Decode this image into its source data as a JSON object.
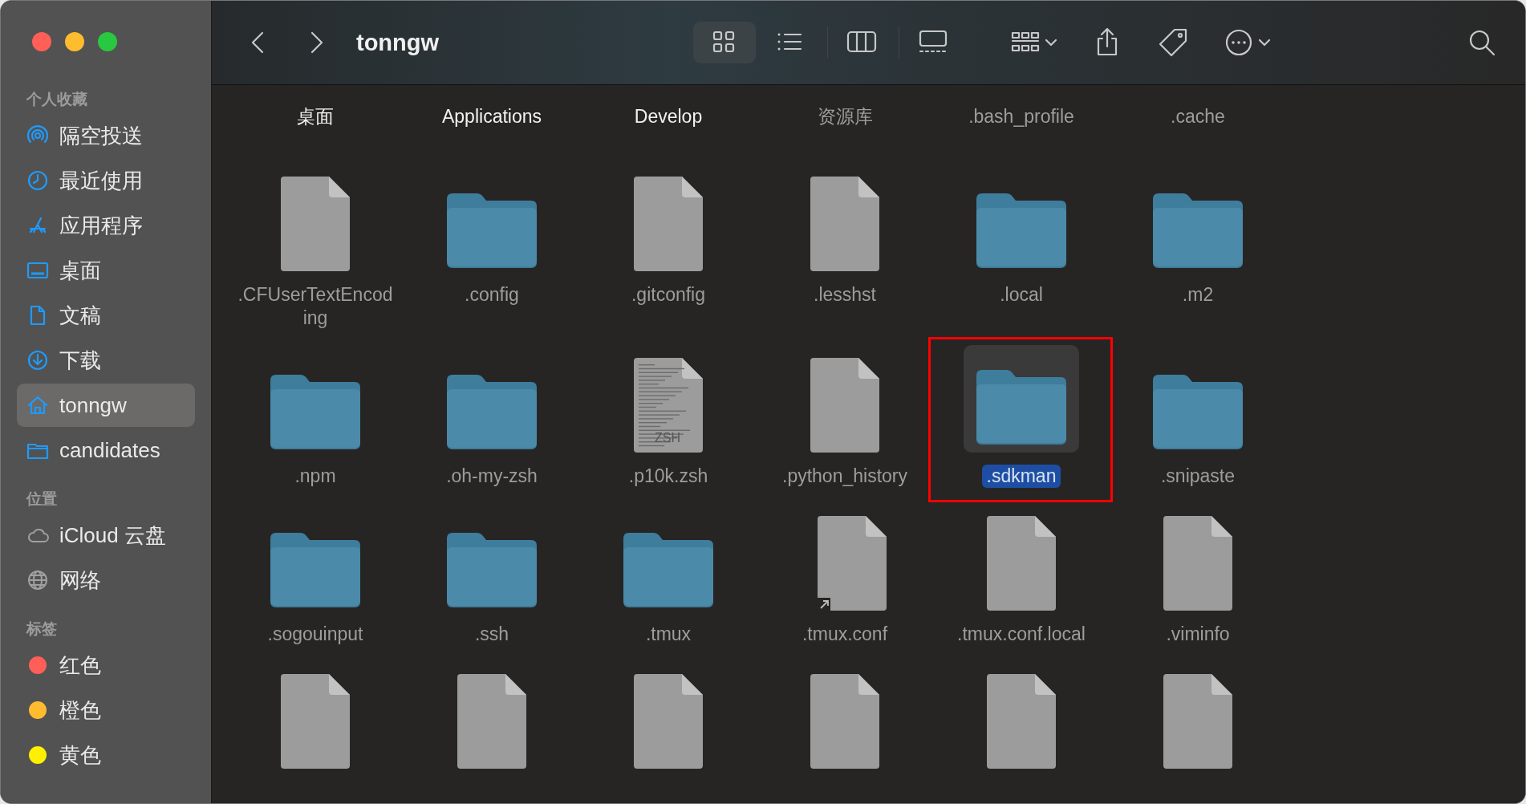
{
  "window": {
    "title": "tonngw"
  },
  "toolbar": {
    "views": [
      {
        "kind": "icons",
        "selected": true
      },
      {
        "kind": "list",
        "selected": false
      },
      {
        "kind": "columns",
        "selected": false
      },
      {
        "kind": "gallery",
        "selected": false
      }
    ]
  },
  "sidebar": {
    "sections": [
      {
        "header": "个人收藏",
        "items": [
          {
            "label": "隔空投送",
            "selected": false
          },
          {
            "label": "最近使用",
            "selected": false
          },
          {
            "label": "应用程序",
            "selected": false
          },
          {
            "label": "桌面",
            "selected": false
          },
          {
            "label": "文稿",
            "selected": false
          },
          {
            "label": "下载",
            "selected": false
          },
          {
            "label": "tonngw",
            "selected": true
          },
          {
            "label": "candidates",
            "selected": false
          }
        ]
      },
      {
        "header": "位置",
        "items": [
          {
            "label": "iCloud 云盘",
            "selected": false
          },
          {
            "label": "网络",
            "selected": false
          }
        ]
      },
      {
        "header": "标签",
        "items": [
          {
            "label": "红色",
            "color": "#ff5f57",
            "selected": false
          },
          {
            "label": "橙色",
            "color": "#febc2e",
            "selected": false
          },
          {
            "label": "黄色",
            "color": "#fff000",
            "selected": false
          }
        ]
      }
    ]
  },
  "files": [
    {
      "name": "桌面",
      "hidden": false,
      "selected": false
    },
    {
      "name": "Applications",
      "hidden": false,
      "selected": false
    },
    {
      "name": "Develop",
      "hidden": false,
      "selected": false
    },
    {
      "name": "资源库",
      "hidden": true,
      "selected": false
    },
    {
      "name": ".bash_profile",
      "hidden": true,
      "selected": false
    },
    {
      "name": ".cache",
      "hidden": true,
      "selected": false
    },
    {
      "name": ".CFUserTextEncoding",
      "kind": "file",
      "hidden": true,
      "selected": false
    },
    {
      "name": ".config",
      "kind": "folder",
      "hidden": true,
      "selected": false
    },
    {
      "name": ".gitconfig",
      "kind": "file",
      "hidden": true,
      "selected": false
    },
    {
      "name": ".lesshst",
      "kind": "file",
      "hidden": true,
      "selected": false
    },
    {
      "name": ".local",
      "kind": "folder",
      "hidden": true,
      "selected": false
    },
    {
      "name": ".m2",
      "kind": "folder",
      "hidden": true,
      "selected": false
    },
    {
      "name": ".npm",
      "kind": "folder",
      "hidden": true,
      "selected": false
    },
    {
      "name": ".oh-my-zsh",
      "kind": "folder",
      "hidden": true,
      "selected": false
    },
    {
      "name": ".p10k.zsh",
      "kind": "script",
      "badge": "ZSH",
      "hidden": true,
      "selected": false
    },
    {
      "name": ".python_history",
      "kind": "file",
      "hidden": true,
      "selected": false
    },
    {
      "name": ".sdkman",
      "kind": "folder",
      "hidden": true,
      "selected": true,
      "annotated": true
    },
    {
      "name": ".snipaste",
      "kind": "folder",
      "hidden": true,
      "selected": false
    },
    {
      "name": ".sogouinput",
      "kind": "folder",
      "hidden": true,
      "selected": false
    },
    {
      "name": ".ssh",
      "kind": "folder",
      "hidden": true,
      "selected": false
    },
    {
      "name": ".tmux",
      "kind": "folder",
      "hidden": true,
      "selected": false
    },
    {
      "name": ".tmux.conf",
      "kind": "file",
      "alias": true,
      "hidden": true,
      "selected": false
    },
    {
      "name": ".tmux.conf.local",
      "kind": "file",
      "hidden": true,
      "selected": false
    },
    {
      "name": ".viminfo",
      "kind": "file",
      "hidden": true,
      "selected": false
    },
    {
      "kind": "file"
    },
    {
      "kind": "file"
    },
    {
      "kind": "file"
    },
    {
      "kind": "file"
    },
    {
      "kind": "file"
    },
    {
      "kind": "file"
    }
  ]
}
